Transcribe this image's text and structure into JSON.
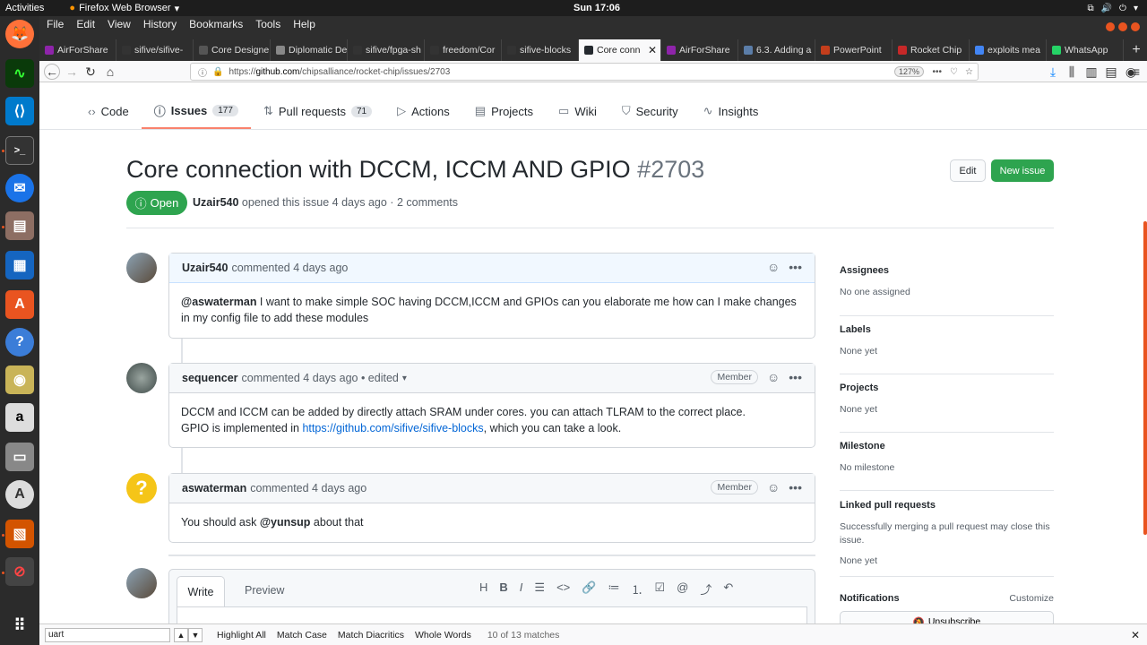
{
  "topbar": {
    "activities": "Activities",
    "app": "Firefox Web Browser",
    "clock": "Sun 17:06"
  },
  "menus": [
    "File",
    "Edit",
    "View",
    "History",
    "Bookmarks",
    "Tools",
    "Help"
  ],
  "tabs": [
    {
      "label": "AirForShare",
      "color": "#8e24aa"
    },
    {
      "label": "sifive/sifive-",
      "color": "#333333"
    },
    {
      "label": "Core Designe",
      "color": "#555555"
    },
    {
      "label": "Diplomatic Desi",
      "color": "#888888"
    },
    {
      "label": "sifive/fpga-sh",
      "color": "#333333"
    },
    {
      "label": "freedom/Cor",
      "color": "#333333"
    },
    {
      "label": "sifive-blocks",
      "color": "#333333"
    },
    {
      "label": "Core conn",
      "color": "#24292e"
    },
    {
      "label": "AirForShare",
      "color": "#8e24aa"
    },
    {
      "label": "6.3. Adding a",
      "color": "#5b7da8"
    },
    {
      "label": "PowerPoint",
      "color": "#c43e1c"
    },
    {
      "label": "Rocket Chip",
      "color": "#c62828"
    },
    {
      "label": "exploits mea",
      "color": "#4285f4"
    },
    {
      "label": "WhatsApp",
      "color": "#25d366"
    }
  ],
  "url": {
    "prefix": "https://",
    "domain": "github.com",
    "path": "/chipsalliance/rocket-chip/issues/2703",
    "zoom": "127%"
  },
  "repo_tabs": [
    {
      "label": "Code",
      "icon": "‹›",
      "count": ""
    },
    {
      "label": "Issues",
      "icon": "ⓘ",
      "count": "177"
    },
    {
      "label": "Pull requests",
      "icon": "⇅",
      "count": "71"
    },
    {
      "label": "Actions",
      "icon": "▷",
      "count": ""
    },
    {
      "label": "Projects",
      "icon": "▤",
      "count": ""
    },
    {
      "label": "Wiki",
      "icon": "▭",
      "count": ""
    },
    {
      "label": "Security",
      "icon": "⛉",
      "count": ""
    },
    {
      "label": "Insights",
      "icon": "∿",
      "count": ""
    }
  ],
  "issue": {
    "title": "Core connection with DCCM, ICCM AND GPIO",
    "number": "#2703",
    "state": "Open",
    "author": "Uzair540",
    "opened_text": " opened this issue 4 days ago · 2 comments",
    "edit_label": "Edit",
    "new_issue_label": "New issue"
  },
  "comments": [
    {
      "author": "Uzair540",
      "meta": "commented 4 days ago",
      "badge": "",
      "mention": "@aswaterman",
      "body": " I want to make simple SOC having DCCM,ICCM and GPIOs can you elaborate me how can I make changes in my config file to add these modules"
    },
    {
      "author": "sequencer",
      "meta": "commented 4 days ago • edited",
      "badge": "Member",
      "line1": "DCCM and ICCM can be added by directly attach SRAM under cores. you can attach TLRAM to the correct place.",
      "line2_pre": "GPIO is implemented in ",
      "link": "https://github.com/sifive/sifive-blocks",
      "line2_post": ", which you can take a look."
    },
    {
      "author": "aswaterman",
      "meta": "commented 4 days ago",
      "badge": "Member",
      "pre": "You should ask ",
      "mention": "@yunsup",
      "post": " about that"
    }
  ],
  "composer": {
    "write": "Write",
    "preview": "Preview",
    "tools": [
      "H",
      "B",
      "I",
      "☰",
      "<>",
      "🔗",
      "≔",
      "⒈",
      "☑",
      "@",
      "⤴",
      "↶"
    ]
  },
  "sidebar": {
    "assignees": {
      "label": "Assignees",
      "value": "No one assigned"
    },
    "labels": {
      "label": "Labels",
      "value": "None yet"
    },
    "projects": {
      "label": "Projects",
      "value": "None yet"
    },
    "milestone": {
      "label": "Milestone",
      "value": "No milestone"
    },
    "linked": {
      "label": "Linked pull requests",
      "value": "Successfully merging a pull request may close this issue.",
      "value2": "None yet"
    },
    "notifications": {
      "label": "Notifications",
      "customize": "Customize",
      "button": "Unsubscribe"
    }
  },
  "findbar": {
    "query": "uart",
    "highlight": "Highlight All",
    "match_case": "Match Case",
    "diacritics": "Match Diacritics",
    "whole": "Whole Words",
    "result": "10 of 13 matches"
  }
}
